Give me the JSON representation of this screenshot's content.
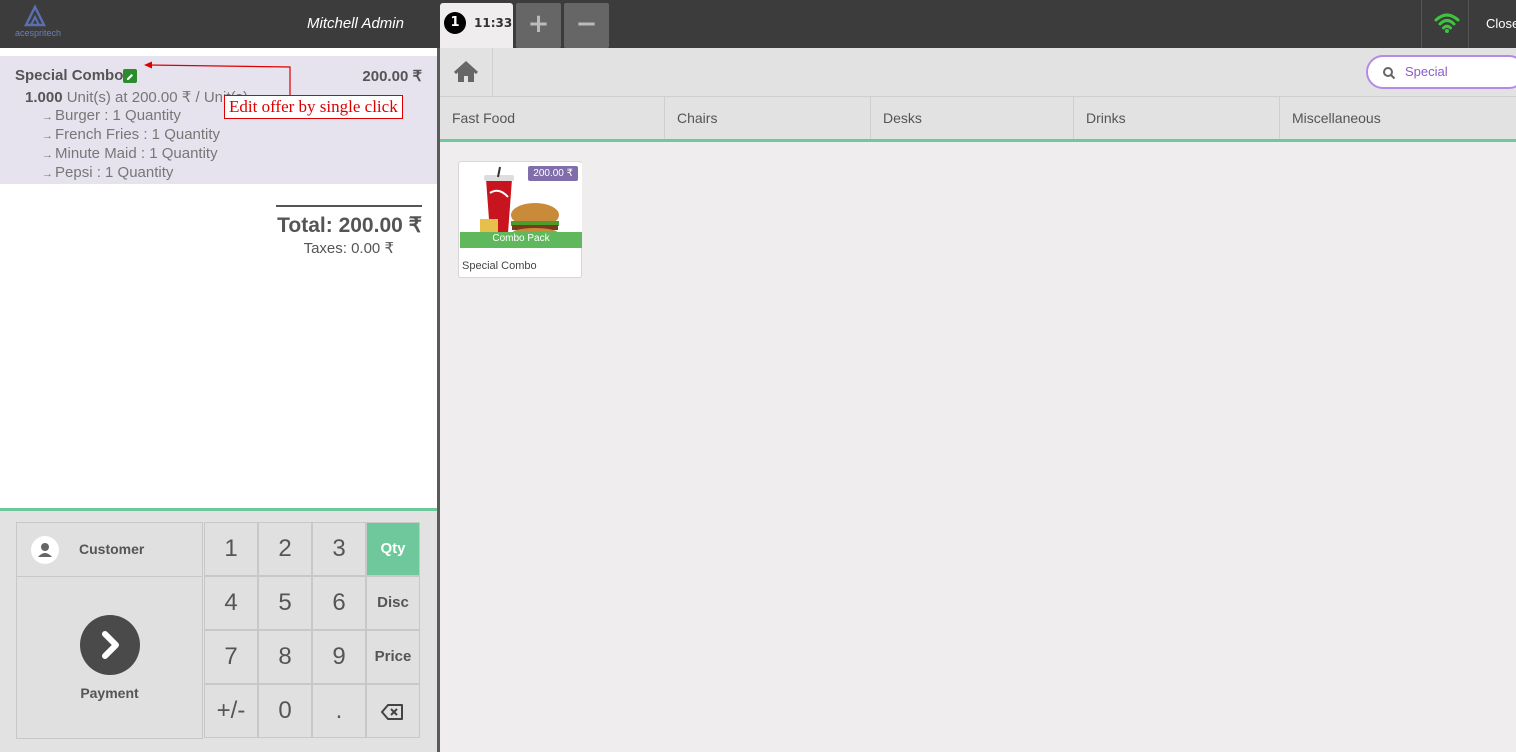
{
  "header": {
    "logo_text": "acespritech",
    "user": "Mitchell Admin",
    "order_number": "1",
    "order_time": "11:33",
    "add_order": "+",
    "remove_order": "−",
    "close": "Close"
  },
  "order": {
    "line": {
      "name": "Special Combo",
      "price": "200.00 ₹",
      "qty": "1.000",
      "unit_info": "Unit(s) at 200.00 ₹ / Unit(s)",
      "items": [
        {
          "label": "Burger : 1 Quantity"
        },
        {
          "label": "French Fries : 1 Quantity"
        },
        {
          "label": "Minute Maid : 1 Quantity"
        },
        {
          "label": "Pepsi : 1 Quantity"
        }
      ]
    },
    "annotation": "Edit offer by single click",
    "total": "Total: 200.00 ₹",
    "taxes": "Taxes: 0.00 ₹"
  },
  "controls": {
    "customer": "Customer",
    "payment": "Payment",
    "keys": [
      "1",
      "2",
      "3",
      "Qty",
      "4",
      "5",
      "6",
      "Disc",
      "7",
      "8",
      "9",
      "Price",
      "+/-",
      "0",
      "."
    ],
    "active_mode": "Qty",
    "accent": "#6ec89b"
  },
  "search": {
    "value": "Special"
  },
  "categories": [
    "Fast Food",
    "Chairs",
    "Desks",
    "Drinks",
    "Miscellaneous"
  ],
  "products": [
    {
      "name": "Special Combo",
      "price": "200.00 ₹",
      "banner": "Combo Pack"
    }
  ]
}
